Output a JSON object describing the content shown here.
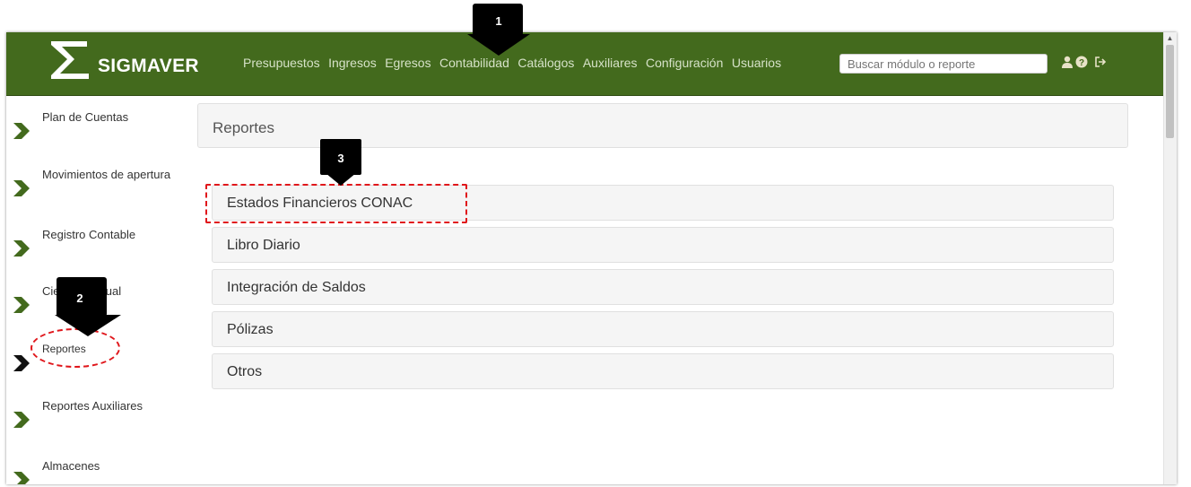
{
  "app": {
    "brand": "SIGMAVER"
  },
  "nav": {
    "menu": [
      "Presupuestos",
      "Ingresos",
      "Egresos",
      "Contabilidad",
      "Catálogos",
      "Auxiliares",
      "Configuración",
      "Usuarios"
    ],
    "search_placeholder": "Buscar módulo o reporte",
    "icons": [
      "user-icon",
      "help-icon",
      "logout-icon"
    ]
  },
  "sidebar": {
    "items": [
      {
        "label": "Plan de Cuentas"
      },
      {
        "label": "Movimientos de apertura"
      },
      {
        "label": "Registro Contable"
      },
      {
        "label": "Cierre Mensual"
      },
      {
        "label": "Reportes"
      },
      {
        "label": "Reportes Auxiliares"
      },
      {
        "label": "Almacenes"
      }
    ]
  },
  "main": {
    "header": "Reportes",
    "reports": [
      {
        "label": "Estados Financieros CONAC"
      },
      {
        "label": "Libro Diario"
      },
      {
        "label": "Integración de Saldos"
      },
      {
        "label": "Pólizas"
      },
      {
        "label": "Otros"
      }
    ]
  },
  "annotations": {
    "callouts": [
      "1",
      "2",
      "3"
    ]
  },
  "colors": {
    "navbar": "#436a1d",
    "chevron": "#436a1d",
    "active_chevron": "#000000",
    "highlight": "#e0161b"
  }
}
